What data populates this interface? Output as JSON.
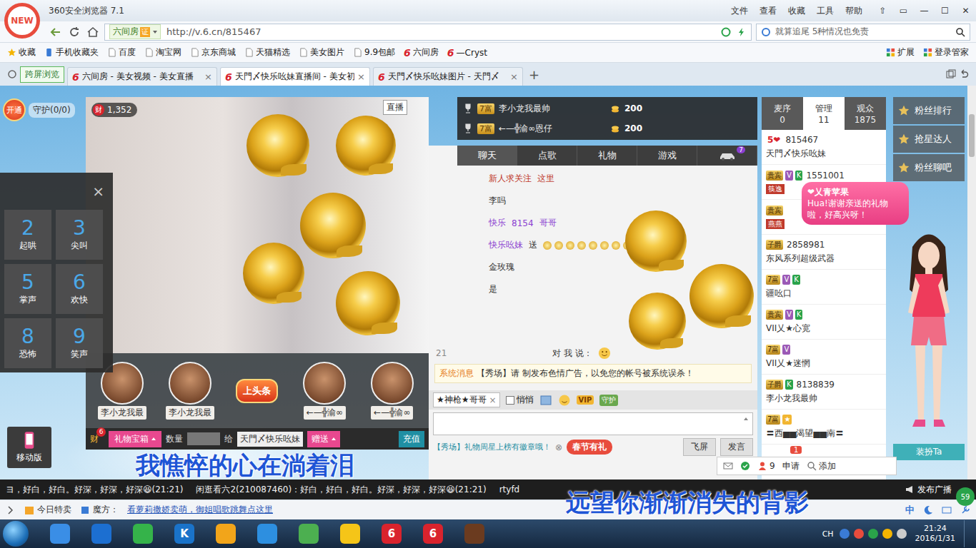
{
  "browser": {
    "logo": "NEW",
    "title": "360安全浏览器 7.1",
    "menu": [
      "文件",
      "查看",
      "收藏",
      "工具",
      "帮助"
    ],
    "window_buttons": [
      "⇧",
      "▭",
      "—",
      "☐",
      "✕"
    ]
  },
  "address_bar": {
    "site_badge": "六间房",
    "cert": "证",
    "url": "http://v.6.cn/815467",
    "search_placeholder": "就算追尾 5种情况也免责"
  },
  "brand": {
    "six": "6"
  },
  "bookmarks": {
    "items": [
      {
        "label": "收藏",
        "kind": "star"
      },
      {
        "label": "手机收藏夹",
        "kind": "phone"
      },
      {
        "label": "百度",
        "kind": "page"
      },
      {
        "label": "淘宝网",
        "kind": "page"
      },
      {
        "label": "京东商城",
        "kind": "page"
      },
      {
        "label": "天猫精选",
        "kind": "page"
      },
      {
        "label": "美女图片",
        "kind": "page"
      },
      {
        "label": "9.9包邮",
        "kind": "page"
      },
      {
        "label": "六间房",
        "kind": "six"
      },
      {
        "label": "—Cryst",
        "kind": "six"
      }
    ],
    "right": [
      "扩展",
      "登录管家"
    ]
  },
  "tabs": {
    "cross_screen": "跨屏浏览",
    "close": "×",
    "new": "+",
    "items": [
      {
        "label": "六间房 - 美女视频 - 美女直播",
        "selected": false
      },
      {
        "label": "天門〆快乐吆妹直播间 - 美女初",
        "selected": true
      },
      {
        "label": "天門〆快乐吆妹图片 - 天門〆",
        "selected": false
      }
    ]
  },
  "guard": {
    "open": "开通",
    "label": "守护(0/0)"
  },
  "video": {
    "wealth_icon": "财",
    "wealth": "1,352",
    "live": "直播"
  },
  "sound_panel": {
    "close": "×",
    "items": [
      {
        "key": "2",
        "label": "起哄"
      },
      {
        "key": "3",
        "label": "尖叫"
      },
      {
        "key": "5",
        "label": "掌声"
      },
      {
        "key": "6",
        "label": "欢快"
      },
      {
        "key": "8",
        "label": "恐怖"
      },
      {
        "key": "9",
        "label": "笑声"
      }
    ]
  },
  "mobile": "移动版",
  "gift_strip": [
    {
      "name": "李小龙我最",
      "kind": "avatar"
    },
    {
      "name": "李小龙我最",
      "kind": "avatar"
    },
    {
      "name": "上头条",
      "kind": "sign"
    },
    {
      "name": "←—╬渝∞",
      "kind": "avatar"
    },
    {
      "name": "←—╬渝∞",
      "kind": "avatar"
    }
  ],
  "gift_bar": {
    "badge": "6",
    "icon": "财",
    "box": "礼物宝箱",
    "qty_label": "数量",
    "to_label": "给",
    "to": "天門〆快乐吆妹",
    "send": "赠送",
    "recharge": "充值"
  },
  "ranking": [
    {
      "level": "7富",
      "name": "李小龙我最帅",
      "amount": "200"
    },
    {
      "level": "7富",
      "name": "←—╬渝∞恩仔",
      "amount": "200"
    }
  ],
  "chat_tabs": [
    {
      "label": "聊天",
      "selected": true
    },
    {
      "label": "点歌",
      "selected": false
    },
    {
      "label": "礼物",
      "selected": false
    },
    {
      "label": "游戏",
      "selected": false
    }
  ],
  "car_badge": "7",
  "chat_lines": [
    {
      "gifts": false,
      "parts": [
        {
          "text": "新人求关注",
          "kind": "notice"
        },
        {
          "text": "这里",
          "kind": "notice"
        }
      ]
    },
    {
      "gifts": false,
      "parts": [
        {
          "text": "李吗",
          "kind": "plain"
        }
      ]
    },
    {
      "gifts": false,
      "parts": [
        {
          "text": "快乐",
          "kind": "name"
        },
        {
          "text": "8154",
          "kind": "name"
        },
        {
          "text": "哥哥",
          "kind": "name"
        }
      ]
    },
    {
      "gifts": true,
      "parts": [
        {
          "text": "快乐吆妹",
          "kind": "name"
        },
        {
          "text": "送",
          "kind": "plain"
        }
      ]
    },
    {
      "gifts": false,
      "parts": [
        {
          "text": "金玫瑰",
          "kind": "plain"
        }
      ]
    },
    {
      "gifts": false,
      "parts": [
        {
          "text": "是",
          "kind": "plain"
        }
      ]
    }
  ],
  "chat_meta": {
    "time": "21",
    "to_me": "对 我 说："
  },
  "system_message": {
    "tag": "系统消息",
    "parts": [
      "【秀场】请",
      "制发布色情广告，以免您的帐号被系统误杀！"
    ]
  },
  "compose": {
    "target": "★神枪★哥哥",
    "target_close": "×",
    "private": "悄悄",
    "private_checked": false,
    "vip": "VIP",
    "guard": "守护",
    "notice": "【秀场】礼物周星上榜有徽章哦！",
    "notice_close": "⊗",
    "festival": "春节有礼",
    "fly": "飞屏",
    "send": "发言"
  },
  "user_tabs": [
    {
      "label": "麦序",
      "count": "0",
      "selected": false
    },
    {
      "label": "管理",
      "count": "11",
      "selected": true
    },
    {
      "label": "观众",
      "count": "1875",
      "selected": false
    }
  ],
  "users": [
    {
      "tags": [
        {
          "text": "5❤",
          "kind": "heart"
        }
      ],
      "id": "815467",
      "name": "天門〆快乐吆妹"
    },
    {
      "tags": [
        {
          "text": "贵宾",
          "kind": "rank"
        },
        {
          "text": "V",
          "kind": "v"
        },
        {
          "text": "K",
          "kind": "k"
        }
      ],
      "id": "1551001",
      "sub_tag": "筷逸"
    },
    {
      "tags": [
        {
          "text": "贵宾",
          "kind": "rank"
        }
      ],
      "sub_tag": "燕燕"
    },
    {
      "tags": [
        {
          "text": "子爵",
          "kind": "rank"
        }
      ],
      "id": "2858981",
      "name": "东风系列超级武器"
    },
    {
      "tags": [
        {
          "text": "7富",
          "kind": "rank"
        },
        {
          "text": "V",
          "kind": "v"
        },
        {
          "text": "K",
          "kind": "k"
        }
      ],
      "name": "疆吆口"
    },
    {
      "tags": [
        {
          "text": "贵宾",
          "kind": "rank"
        },
        {
          "text": "V",
          "kind": "v"
        },
        {
          "text": "K",
          "kind": "k"
        }
      ],
      "name": "VII乂★心宽"
    },
    {
      "tags": [
        {
          "text": "7富",
          "kind": "rank"
        },
        {
          "text": "V",
          "kind": "v"
        }
      ],
      "name": "VII乂★迷惘"
    },
    {
      "tags": [
        {
          "text": "子爵",
          "kind": "rank"
        },
        {
          "text": "K",
          "kind": "k"
        }
      ],
      "id": "8138839",
      "name": "李小龙我最帅"
    },
    {
      "tags": [
        {
          "text": "7富",
          "kind": "rank"
        },
        {
          "text": "★",
          "kind": "star"
        }
      ],
      "name": "〓西▅▅渴望▅▅南〓"
    }
  ],
  "bubble": {
    "title": "❤乂青苹果",
    "text": "Hua!谢谢亲送的礼物啦，好高兴呀！"
  },
  "fans": [
    "粉丝排行",
    "抢星达人",
    "粉丝聊吧"
  ],
  "dress": "装扮Ta",
  "float_bar": {
    "count": "9",
    "apply": "申请",
    "add": "添加",
    "badge": "1"
  },
  "lyrics": [
    "我憔悴的心在淌着泪",
    "远望你渐渐消失的背影"
  ],
  "ticker": {
    "messages": [
      "ヨ，好白，好白。好深，好深，好深😆(21:21)",
      "闲逛看六2(210087460)：好白，好白，好白。好深，好深，好深😆(21:21)",
      "rtyfd"
    ],
    "broadcast": "发布广播",
    "speed": "59"
  },
  "status_bar": {
    "sale": "今日特卖",
    "magic": "魔方：",
    "link": "看萝莉撒娇卖萌，御姐唱歌跳舞点这里",
    "ime": "中"
  },
  "taskbar": {
    "apps": [
      {
        "color": "#3a8ee6"
      },
      {
        "color": "#1c6fd1"
      },
      {
        "color": "#35b34a"
      },
      {
        "color": "#1a73c9",
        "glyph": "K"
      },
      {
        "color": "#f2a51a"
      },
      {
        "color": "#2d8fe0"
      },
      {
        "color": "#4caf50"
      },
      {
        "color": "#f5c518"
      },
      {
        "color": "#d9232d",
        "glyph": "6"
      },
      {
        "color": "#d9232d",
        "glyph": "6"
      },
      {
        "color": "#6b3b1f"
      }
    ],
    "lang": "CH",
    "time": "21:24",
    "date": "2016/1/31"
  }
}
